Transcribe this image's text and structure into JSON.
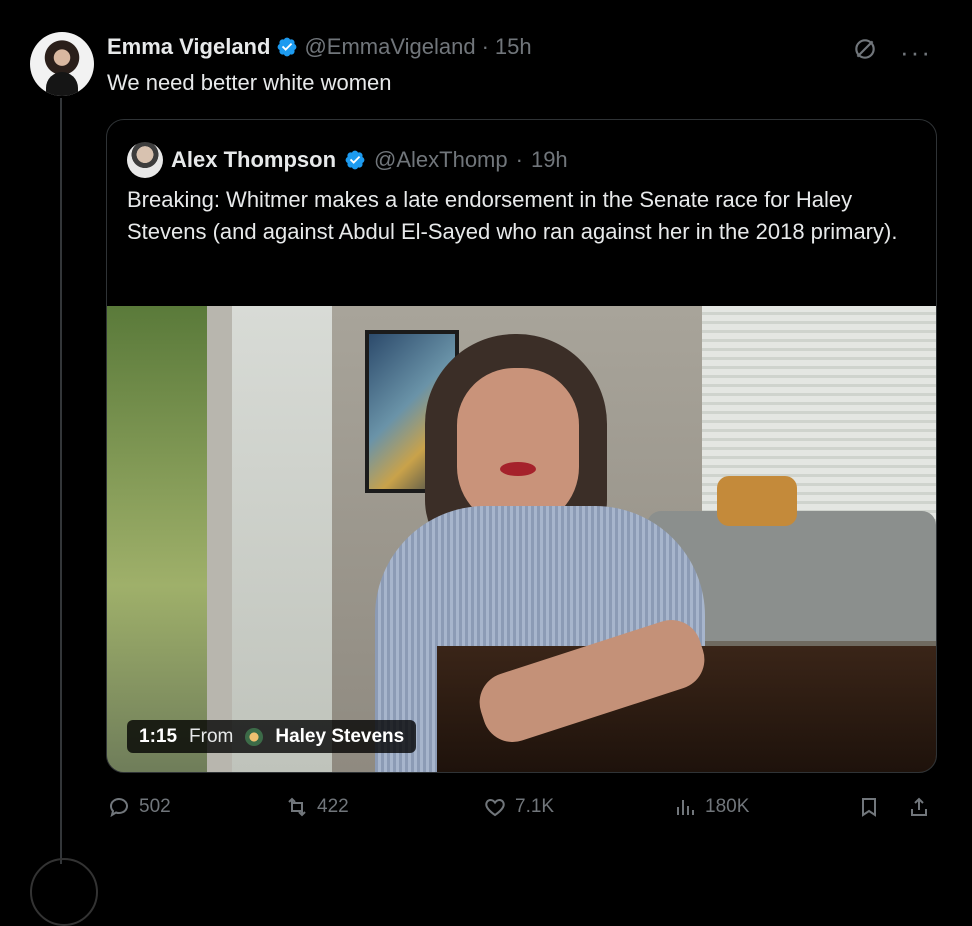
{
  "tweet": {
    "author_name": "Emma Vigeland",
    "author_handle": "@EmmaVigeland",
    "separator": "·",
    "time": "15h",
    "text": "We need better white women",
    "verified": true
  },
  "quoted": {
    "author_name": "Alex Thompson",
    "author_handle": "@AlexThomp",
    "separator": "·",
    "time": "19h",
    "text": "Breaking: Whitmer makes a late endorsement in the Senate race for Haley Stevens (and against Abdul El-Sayed who ran against her in the 2018 primary).",
    "verified": true,
    "video": {
      "duration": "1:15",
      "from_label": "From",
      "source_name": "Haley Stevens"
    }
  },
  "actions": {
    "replies": "502",
    "reposts": "422",
    "likes": "7.1K",
    "views": "180K"
  },
  "icons": {
    "verified": "verified-badge-icon",
    "grok": "grok-icon",
    "more": "more-icon",
    "reply": "reply-icon",
    "repost": "repost-icon",
    "like": "heart-icon",
    "views": "views-icon",
    "bookmark": "bookmark-icon",
    "share": "share-icon"
  },
  "colors": {
    "background": "#000000",
    "text": "#e7e9ea",
    "muted": "#71767b",
    "verified": "#1d9bf0",
    "border": "#2f3336"
  }
}
